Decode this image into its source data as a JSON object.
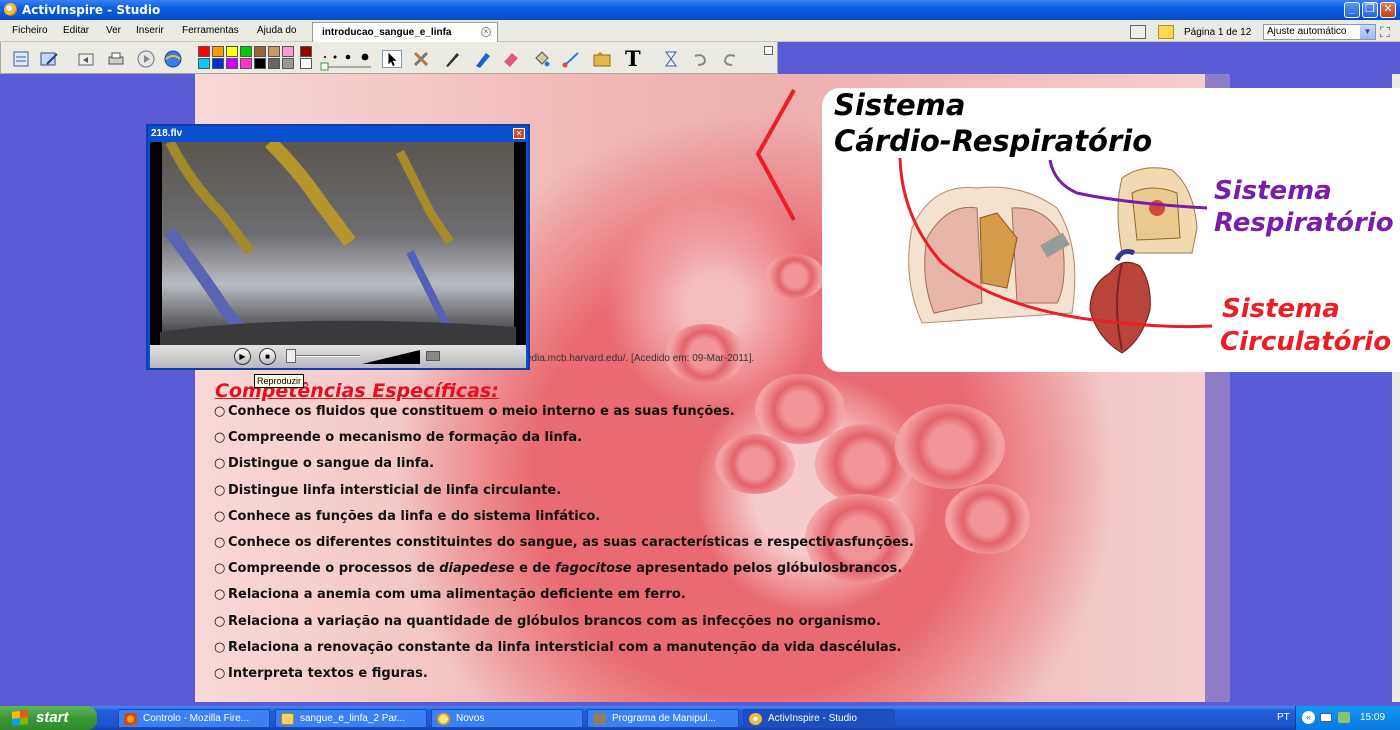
{
  "window": {
    "title": "ActivInspire - Studio"
  },
  "menu": [
    "Ficheiro",
    "Editar",
    "Ver",
    "Inserir",
    "Ferramentas",
    "Ajuda do"
  ],
  "document_tab": {
    "label": "introducao_sangue_e_linfa"
  },
  "pagination": {
    "text": "Página 1 de 12",
    "zoom": "Ajuste automático"
  },
  "palette": [
    "#ff0000",
    "#ff9900",
    "#ffff00",
    "#00cc00",
    "#996633",
    "#cc9966",
    "#ff99cc",
    "#990000",
    "#00ccff",
    "#0033cc",
    "#cc00ff",
    "#ff33cc",
    "#000000",
    "#666666",
    "#999999",
    "#ffffff"
  ],
  "player": {
    "title": "218.flv",
    "tooltip": "Reproduzir"
  },
  "citation": "edia.mcb.harvard.edu/. [Acedido em: 09-Mar-2011].",
  "competencias": {
    "title": "Competências Específicas:",
    "items": [
      "Conhece os fluidos que constituem o meio interno e as suas funções.",
      "Compreende o mecanismo de formação da linfa.",
      "Distingue o sangue da linfa.",
      "Distingue linfa intersticial de linfa circulante.",
      "Conhece as funções da linfa e do sistema linfático.",
      "Conhece os diferentes constituintes do sangue, as suas características e respectivasfunções.",
      "Relaciona a anemia com uma alimentação deficiente em ferro.",
      "Relaciona a variação na quantidade de glóbulos brancos com as infecções no organismo.",
      "Relaciona a renovação constante da linfa intersticial com a manutenção da vida dascélulas.",
      "Interpreta textos e figuras."
    ],
    "item7": {
      "pre": "Compreende o processos de ",
      "em1": "diapedese",
      "mid": " e de ",
      "em2": "fagocitose",
      "post": " apresentado pelos glóbulosbrancos."
    }
  },
  "diagram": {
    "title_line1": "Sistema",
    "title_line2": "Cárdio-Respiratório",
    "resp_line1": "Sistema",
    "resp_line2": "Respiratório",
    "circ_line1": "Sistema",
    "circ_line2": "Circulatório",
    "colors": {
      "respiratory": "#7a1ea8",
      "circulatory": "#ee1c24"
    }
  },
  "taskbar": {
    "start": "start",
    "tasks": [
      "Controlo - Mozilla Fire...",
      "sangue_e_linfa_2 Par...",
      "Novos",
      "Programa de Manipul...",
      "ActivInspire - Studio"
    ],
    "language": "PT",
    "time": "15:09"
  }
}
